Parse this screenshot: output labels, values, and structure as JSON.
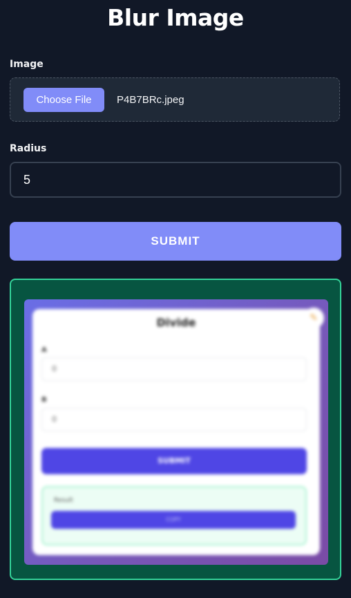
{
  "page": {
    "title": "Blur Image"
  },
  "form": {
    "image_label": "Image",
    "choose_file_label": "Choose File",
    "file_name": "P4B7BRc.jpeg",
    "radius_label": "Radius",
    "radius_value": "5",
    "submit_label": "SUBMIT"
  },
  "result": {
    "preview": {
      "title": "Divide",
      "field_a_label": "A",
      "field_a_value": "0",
      "field_b_label": "B",
      "field_b_value": "0",
      "submit_label": "SUBMIT",
      "result_text": "Result",
      "copy_label": "COPY",
      "fab_icon": "pencil-icon"
    }
  },
  "colors": {
    "background": "#111827",
    "accent": "#818cf8",
    "result_border": "#34d399",
    "result_bg": "#075541"
  }
}
